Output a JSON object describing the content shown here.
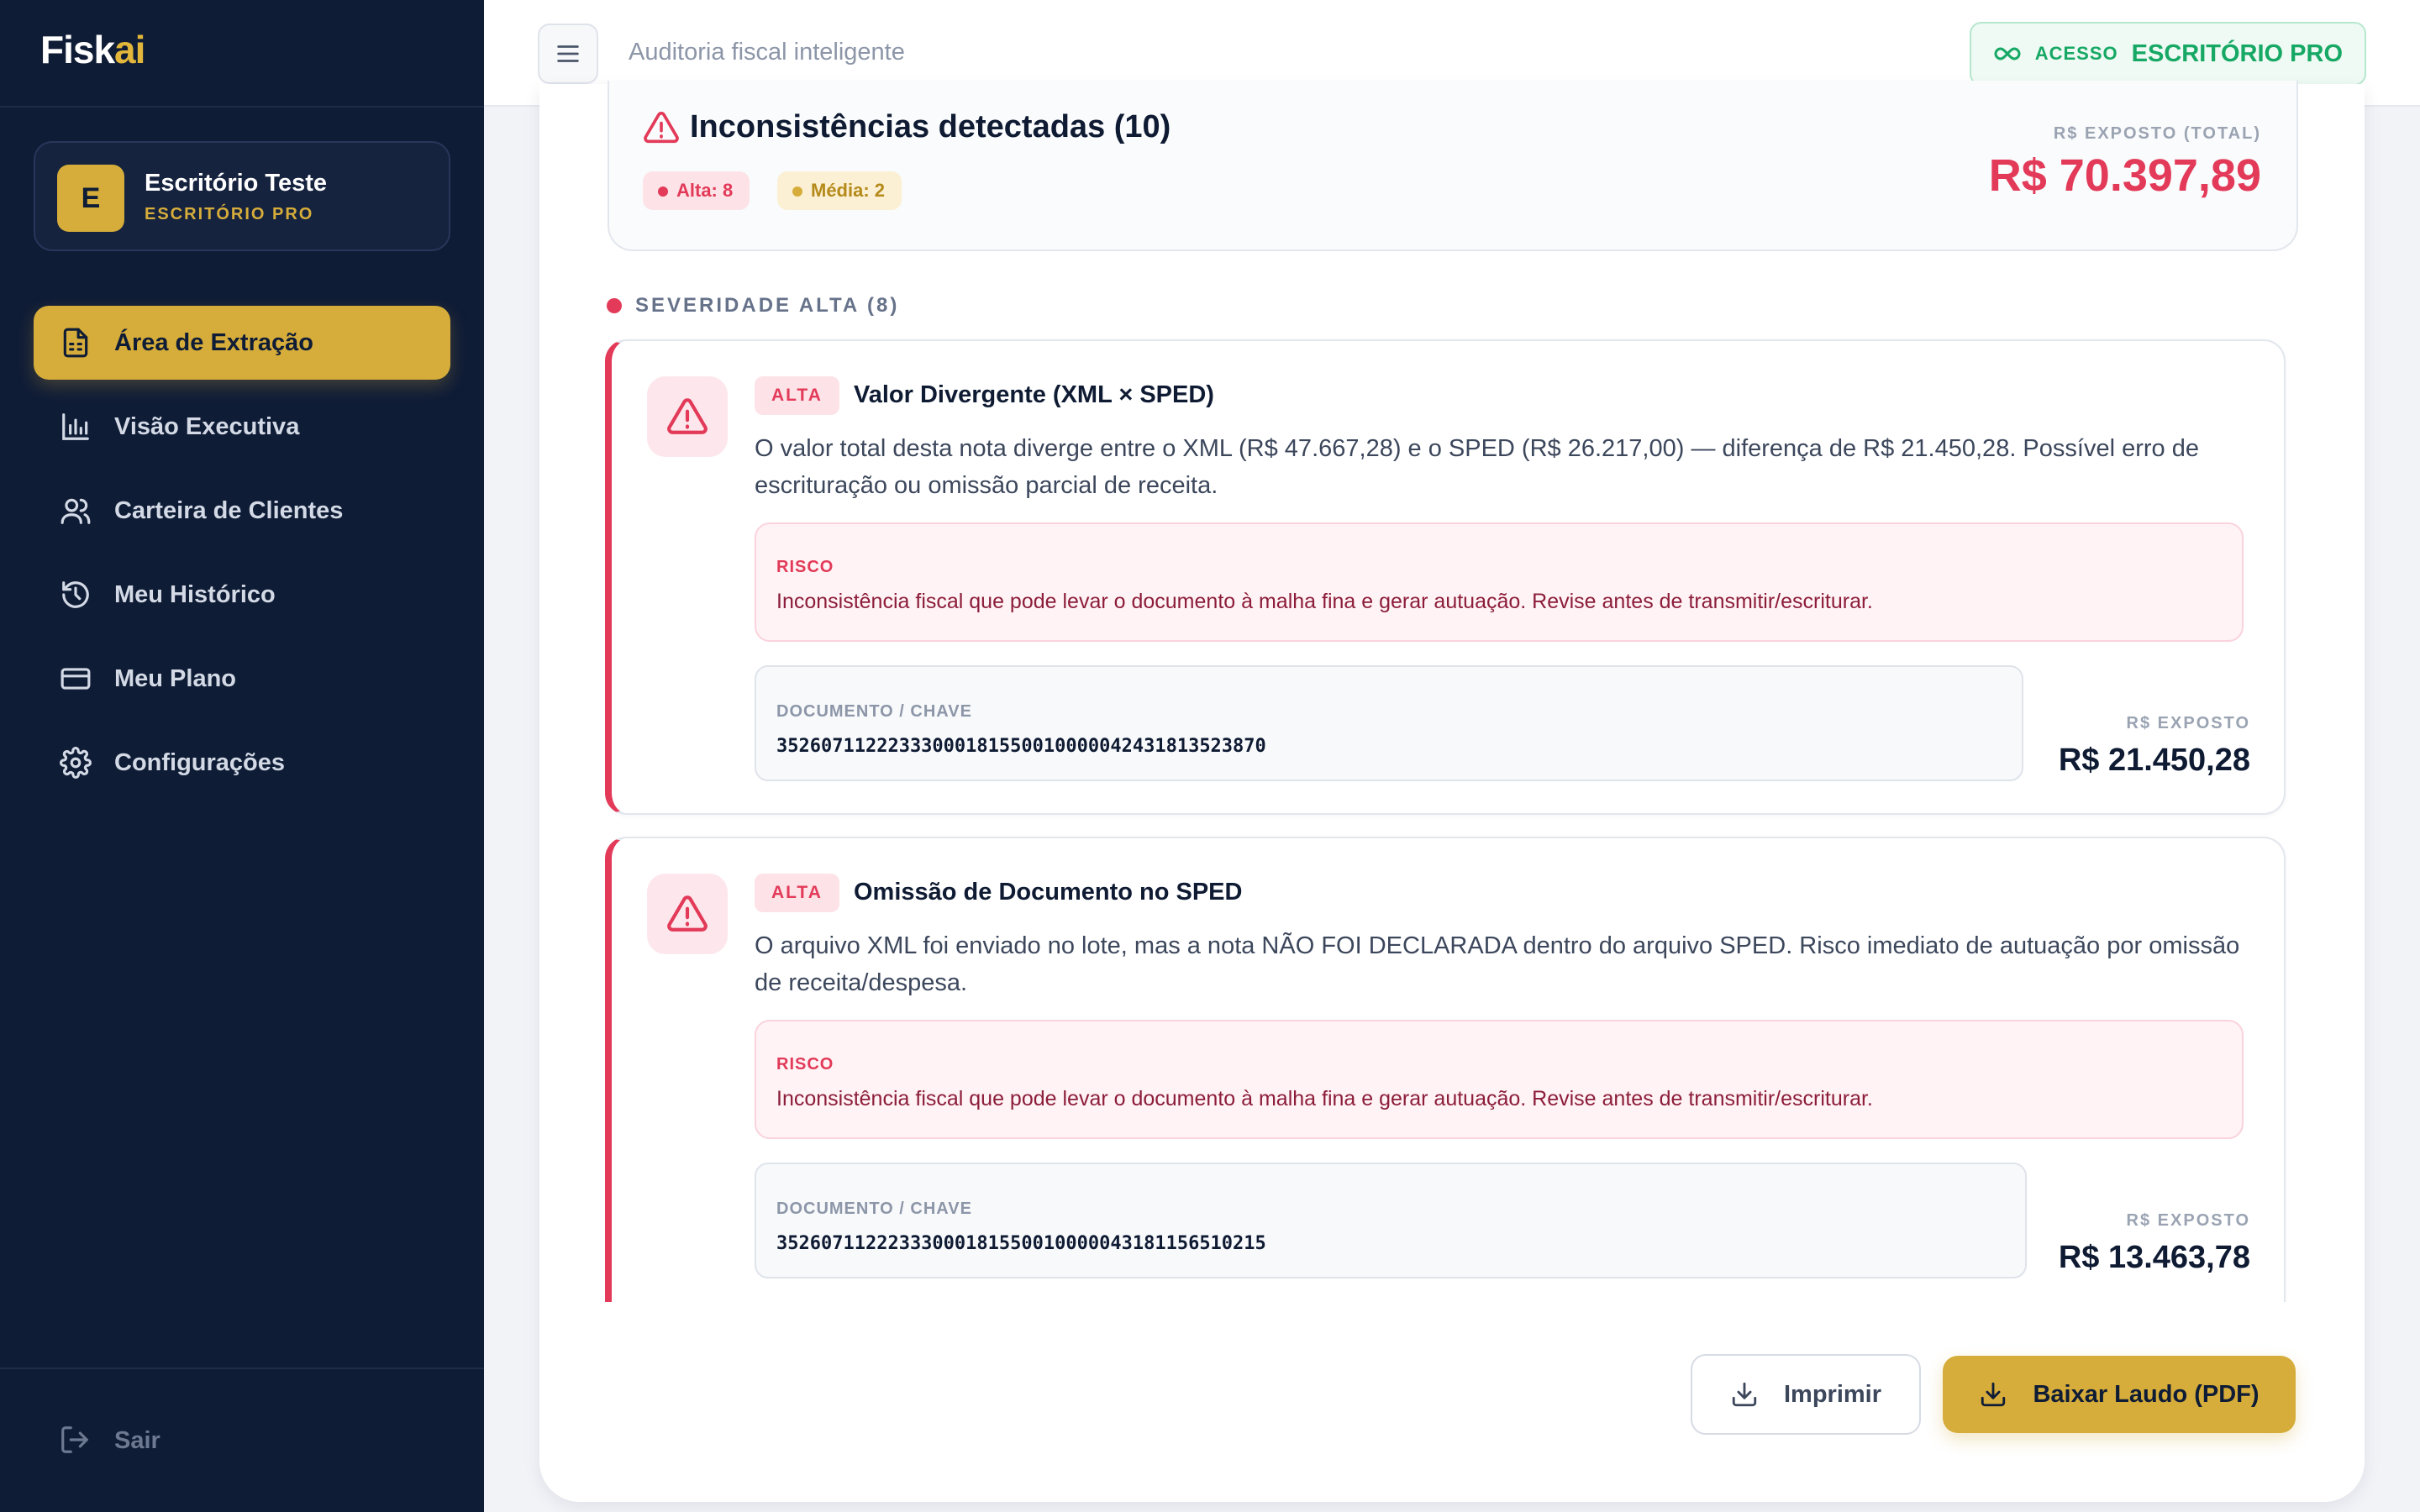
{
  "app": {
    "logo_main": "Fisk",
    "logo_accent": "ai"
  },
  "organization": {
    "avatar_letter": "E",
    "name": "Escritório Teste",
    "plan": "ESCRITÓRIO PRO"
  },
  "sidebar": {
    "items": [
      {
        "label": "Área de Extração",
        "icon": "document-icon",
        "active": true
      },
      {
        "label": "Visão Executiva",
        "icon": "bar-chart-icon",
        "active": false
      },
      {
        "label": "Carteira de Clientes",
        "icon": "users-icon",
        "active": false
      },
      {
        "label": "Meu Histórico",
        "icon": "history-icon",
        "active": false
      },
      {
        "label": "Meu Plano",
        "icon": "credit-card-icon",
        "active": false
      },
      {
        "label": "Configurações",
        "icon": "gear-icon",
        "active": false
      }
    ],
    "logout_label": "Sair"
  },
  "header": {
    "subtitle": "Auditoria fiscal inteligente",
    "access_label": "ACESSO",
    "access_plan": "ESCRITÓRIO PRO"
  },
  "summary": {
    "title": "Inconsistências detectadas (10)",
    "alta_pill": "Alta: 8",
    "media_pill": "Média: 2",
    "exposed_total_label": "R$ EXPOSTO (TOTAL)",
    "exposed_total_value": "R$ 70.397,89"
  },
  "severity_section": {
    "heading": "SEVERIDADE ALTA (8)"
  },
  "issues": [
    {
      "severity": "ALTA",
      "title": "Valor Divergente (XML × SPED)",
      "description": "O valor total desta nota diverge entre o XML (R$ 47.667,28) e o SPED (R$ 26.217,00) — diferença de R$ 21.450,28. Possível erro de escrituração ou omissão parcial de receita.",
      "risk_label": "RISCO",
      "risk_text": "Inconsistência fiscal que pode levar o documento à malha fina e gerar autuação. Revise antes de transmitir/escriturar.",
      "doc_label": "DOCUMENTO / CHAVE",
      "doc_key": "35260711222333000181550010000042431813523870",
      "exposed_label": "R$ EXPOSTO",
      "exposed_value": "R$ 21.450,28"
    },
    {
      "severity": "ALTA",
      "title": "Omissão de Documento no SPED",
      "description": "O arquivo XML foi enviado no lote, mas a nota NÃO FOI DECLARADA dentro do arquivo SPED. Risco imediato de autuação por omissão de receita/despesa.",
      "risk_label": "RISCO",
      "risk_text": "Inconsistência fiscal que pode levar o documento à malha fina e gerar autuação. Revise antes de transmitir/escriturar.",
      "doc_label": "DOCUMENTO / CHAVE",
      "doc_key": "35260711222333000181550010000043181156510215",
      "exposed_label": "R$ EXPOSTO",
      "exposed_value": "R$ 13.463,78"
    }
  ],
  "actions": {
    "print_label": "Imprimir",
    "pdf_label": "Baixar Laudo (PDF)"
  },
  "colors": {
    "sidebar_bg": "#0f1c36",
    "accent": "#d6ad3a",
    "danger": "#e23a58",
    "success": "#16a864"
  }
}
